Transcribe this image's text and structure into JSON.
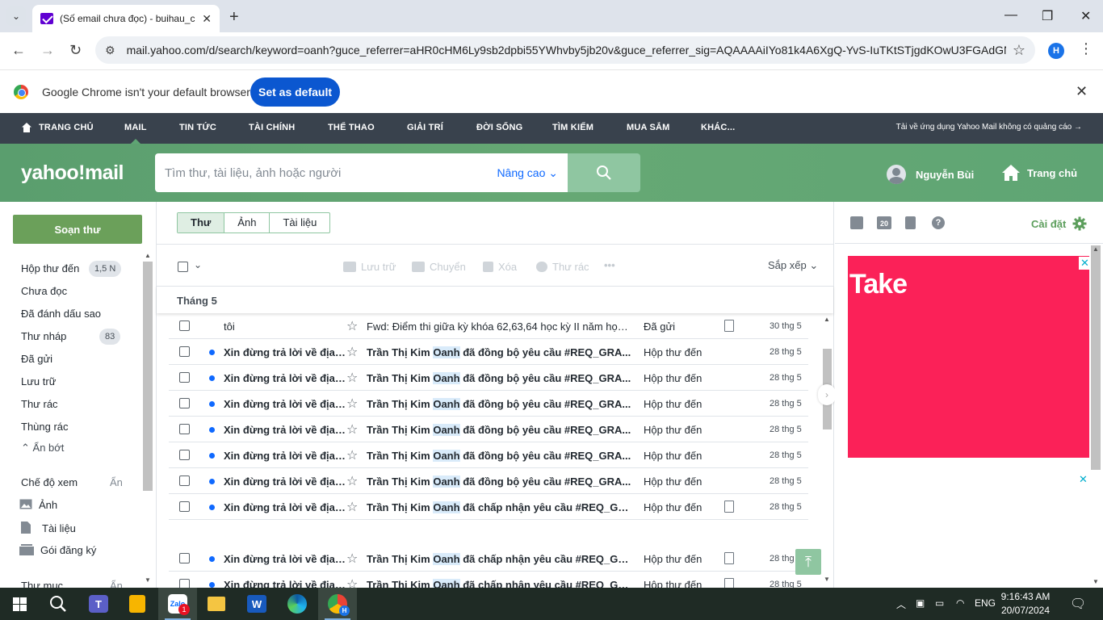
{
  "browser": {
    "tab_title": "(Số email chưa đọc) - buihau_c",
    "url": "mail.yahoo.com/d/search/keyword=oanh?guce_referrer=aHR0cHM6Ly9sb2dpbi55YWhvby5jb20v&guce_referrer_sig=AQAAAAiIYo81k4A6XgQ-YvS-IuTKtSTjgdKOwU3FGAdGN...",
    "profile_letter": "H",
    "infobar_text": "Google Chrome isn't your default browser",
    "infobar_button": "Set as default"
  },
  "topnav": {
    "items": [
      "TRANG CHỦ",
      "MAIL",
      "TIN TỨC",
      "TÀI CHÍNH",
      "THỂ THAO",
      "GIẢI TRÍ",
      "ĐỜI SỐNG",
      "TÌM KIẾM",
      "MUA SẮM",
      "KHÁC..."
    ],
    "promo": "Tải về ứng dụng Yahoo Mail không có quảng cáo"
  },
  "header": {
    "logo": "yahoo!mail",
    "search_placeholder": "Tìm thư, tài liệu, ảnh hoặc người",
    "advanced_label": "Nâng cao",
    "user_name": "Nguyễn Bùi",
    "home_label": "Trang chủ"
  },
  "sidebar": {
    "compose": "Soạn thư",
    "folders": [
      {
        "label": "Hộp thư đến",
        "badge": "1,5 N"
      },
      {
        "label": "Chưa đọc",
        "badge": ""
      },
      {
        "label": "Đã đánh dấu sao",
        "badge": ""
      },
      {
        "label": "Thư nháp",
        "badge": "83"
      },
      {
        "label": "Đã gửi",
        "badge": ""
      },
      {
        "label": "Lưu trữ",
        "badge": ""
      },
      {
        "label": "Thư rác",
        "badge": ""
      },
      {
        "label": "Thùng rác",
        "badge": ""
      }
    ],
    "less": "Ẩn bớt",
    "views_label": "Chế độ xem",
    "views_hide": "Ẩn",
    "views": [
      "Ảnh",
      "Tài liệu",
      "Gói đăng ký"
    ],
    "folders_label": "Thư mục",
    "folders_hide": "Ẩn"
  },
  "main": {
    "tabs": [
      "Thư",
      "Ảnh",
      "Tài liệu"
    ],
    "toolbar": {
      "archive": "Lưu trữ",
      "move": "Chuyển",
      "delete": "Xóa",
      "spam": "Thư rác",
      "more": "•••",
      "sort": "Sắp xếp"
    },
    "month": "Tháng 5",
    "messages": [
      {
        "sender": "tôi",
        "subject_pre": "Fwd: Điểm thi giữa kỳ khóa 62,63,64 học kỳ II năm học ...",
        "hl": "",
        "subject_post": "",
        "folder": "Đã gửi",
        "date": "30 thg 5",
        "unread": false,
        "attachment": true
      },
      {
        "sender": "Xin đừng trả lời về địa ...",
        "subject_pre": "Trần Thị Kim ",
        "hl": "Oanh",
        "subject_post": " đã đồng bộ yêu cầu #REQ_GRA...",
        "folder": "Hộp thư đến",
        "date": "28 thg 5",
        "unread": true,
        "attachment": false
      },
      {
        "sender": "Xin đừng trả lời về địa ...",
        "subject_pre": "Trần Thị Kim ",
        "hl": "Oanh",
        "subject_post": " đã đồng bộ yêu cầu #REQ_GRA...",
        "folder": "Hộp thư đến",
        "date": "28 thg 5",
        "unread": true,
        "attachment": false
      },
      {
        "sender": "Xin đừng trả lời về địa ...",
        "subject_pre": "Trần Thị Kim ",
        "hl": "Oanh",
        "subject_post": " đã đồng bộ yêu cầu #REQ_GRA...",
        "folder": "Hộp thư đến",
        "date": "28 thg 5",
        "unread": true,
        "attachment": false
      },
      {
        "sender": "Xin đừng trả lời về địa ...",
        "subject_pre": "Trần Thị Kim ",
        "hl": "Oanh",
        "subject_post": " đã đồng bộ yêu cầu #REQ_GRA...",
        "folder": "Hộp thư đến",
        "date": "28 thg 5",
        "unread": true,
        "attachment": false
      },
      {
        "sender": "Xin đừng trả lời về địa ...",
        "subject_pre": "Trần Thị Kim ",
        "hl": "Oanh",
        "subject_post": " đã đồng bộ yêu cầu #REQ_GRA...",
        "folder": "Hộp thư đến",
        "date": "28 thg 5",
        "unread": true,
        "attachment": false
      },
      {
        "sender": "Xin đừng trả lời về địa ...",
        "subject_pre": "Trần Thị Kim ",
        "hl": "Oanh",
        "subject_post": " đã đồng bộ yêu cầu #REQ_GRA...",
        "folder": "Hộp thư đến",
        "date": "28 thg 5",
        "unread": true,
        "attachment": false
      },
      {
        "sender": "Xin đừng trả lời về địa ...",
        "subject_pre": "Trần Thị Kim ",
        "hl": "Oanh",
        "subject_post": " đã chấp nhận yêu cầu #REQ_GR...",
        "folder": "Hộp thư đến",
        "date": "28 thg 5",
        "unread": true,
        "attachment": true
      },
      {
        "sender": "Xin đừng trả lời về địa ...",
        "subject_pre": "Trần Thị Kim ",
        "hl": "Oanh",
        "subject_post": " đã chấp nhận yêu cầu #REQ_GR...",
        "folder": "Hộp thư đến",
        "date": "28 thg 5",
        "unread": true,
        "attachment": true
      },
      {
        "sender": "Xin đừng trả lời về địa ...",
        "subject_pre": "Trần Thị Kim ",
        "hl": "Oanh",
        "subject_post": " đã chấp nhận yêu cầu #REQ_GR...",
        "folder": "Hộp thư đến",
        "date": "28 thg 5",
        "unread": true,
        "attachment": true
      }
    ]
  },
  "right": {
    "settings": "Cài đặt",
    "calendar_day": "20",
    "ad_text": "Take"
  },
  "taskbar": {
    "lang": "ENG",
    "time": "9:16:43 AM",
    "date": "20/07/2024",
    "zalo_badge": "1",
    "chrome_badge": "H"
  },
  "colors": {
    "yahoo_green": "#66a874",
    "compose_green": "#6ba05a",
    "unread_dot": "#0f69ff",
    "highlight": "#d9ebfa",
    "ad_bg": "#fb2158"
  }
}
